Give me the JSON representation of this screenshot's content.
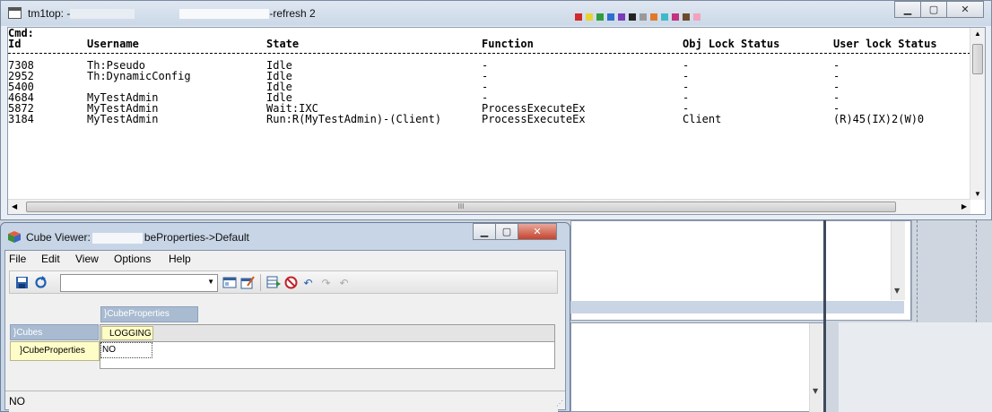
{
  "terminal": {
    "title": "tm1top: -",
    "title_tail": "-refresh 2",
    "cmd_label": "Cmd:",
    "columns": [
      "Id",
      "Username",
      "State",
      "Function",
      "Obj Lock Status",
      "User lock Status"
    ],
    "separator": "-",
    "rows": [
      [
        "7308",
        "Th:Pseudo",
        "Idle",
        "-",
        "-",
        "-"
      ],
      [
        "2952",
        "Th:DynamicConfig",
        "Idle",
        "-",
        "-",
        "-"
      ],
      [
        "5400",
        "",
        "Idle",
        "-",
        "-",
        "-"
      ],
      [
        "4684",
        "MyTestAdmin",
        "Idle",
        "-",
        "-",
        "-"
      ],
      [
        "5872",
        "MyTestAdmin",
        "Wait:IXC",
        "ProcessExecuteEx",
        "-",
        "-"
      ],
      [
        "3184",
        "MyTestAdmin",
        "Run:R(MyTestAdmin)-(Client)",
        "ProcessExecuteEx",
        "Client",
        "(R)45(IX)2(W)0"
      ]
    ],
    "scroll_grip": "III"
  },
  "cube_viewer": {
    "title_prefix": "Cube Viewer:",
    "title_suffix": "beProperties->Default",
    "menu": [
      "File",
      "Edit",
      "View",
      "Options",
      "Help"
    ],
    "titles_dimension": "}CubeProperties",
    "rows_dimension": "}Cubes",
    "column_element": "LOGGING",
    "row_element": "}CubeProperties",
    "cell_value": "NO",
    "status_text": "NO"
  },
  "colors": {
    "title_bar": "#cbd8e7",
    "dimension_tab": "#a9bbd1",
    "element_bg": "#fffdc7",
    "close_red": "#c5442e"
  }
}
